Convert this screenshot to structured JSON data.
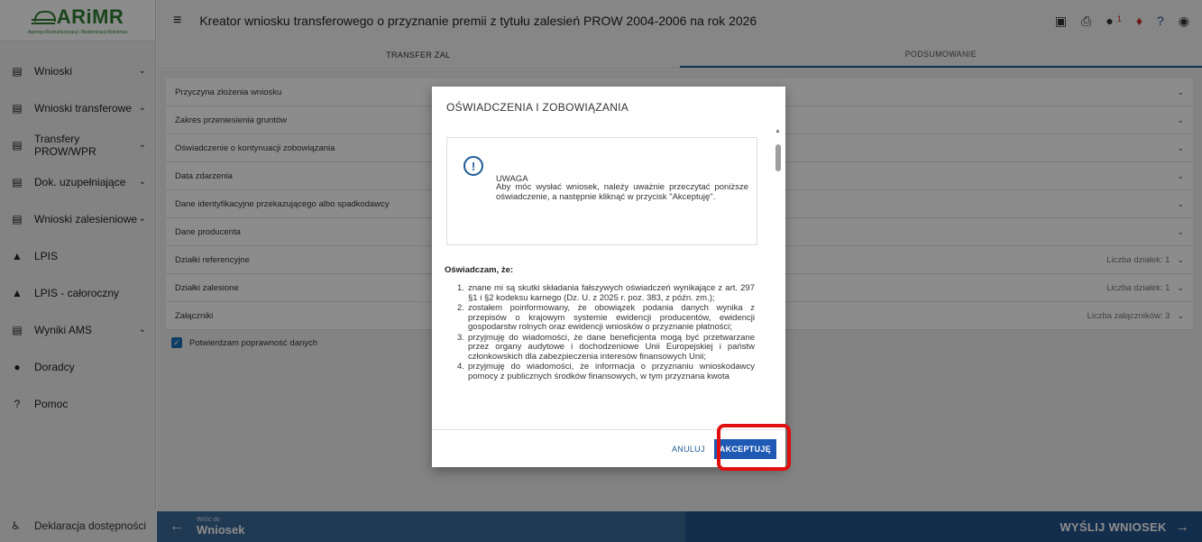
{
  "logo": {
    "brand": "ARiMR",
    "subtitle": "Agencja Restrukturyzacji i Modernizacji Rolnictwa"
  },
  "sidebar": {
    "items": [
      {
        "label": "Wnioski",
        "icon": "clipboard-icon",
        "chevron": "⌄"
      },
      {
        "label": "Wnioski transferowe",
        "icon": "clipboard-icon",
        "chevron": "⌄"
      },
      {
        "label": "Transfery PROW/WPR",
        "icon": "clipboard-icon",
        "chevron": "⌄"
      },
      {
        "label": "Dok. uzupełniające",
        "icon": "clipboard-icon",
        "chevron": "⌄"
      },
      {
        "label": "Wnioski zalesieniowe",
        "icon": "clipboard-icon",
        "chevron": "⌄"
      },
      {
        "label": "LPIS",
        "icon": "terrain-icon",
        "chevron": ""
      },
      {
        "label": "LPIS - całoroczny",
        "icon": "terrain-icon",
        "chevron": ""
      },
      {
        "label": "Wyniki AMS",
        "icon": "clipboard-icon",
        "chevron": "⌄"
      },
      {
        "label": "Doradcy",
        "icon": "person-icon",
        "chevron": ""
      },
      {
        "label": "Pomoc",
        "icon": "help-icon",
        "chevron": ""
      }
    ],
    "footer": "Deklaracja dostępności"
  },
  "topbar": {
    "title": "Kreator wniosku transferowego o przyznanie premii z tytułu zalesień PROW 2004-2006 na rok 2026",
    "notification_count": "1"
  },
  "tabs": [
    {
      "label": "TRANSFER ZAL"
    },
    {
      "label": "PODSUMOWANIE"
    }
  ],
  "panels": [
    {
      "label": "Przyczyna złożenia wniosku",
      "info": ""
    },
    {
      "label": "Zakres przeniesienia gruntów",
      "info": ""
    },
    {
      "label": "Oświadczenie o kontynuacji zobowiązania",
      "info": ""
    },
    {
      "label": "Data zdarzenia",
      "info": ""
    },
    {
      "label": "Dane identyfikacyjne przekazującego albo spadkodawcy",
      "info": ""
    },
    {
      "label": "Dane producenta",
      "info": ""
    },
    {
      "label": "Działki referencyjne",
      "info": "Liczba działek: 1"
    },
    {
      "label": "Działki zalesione",
      "info": "Liczba działek: 1"
    },
    {
      "label": "Załączniki",
      "info": "Liczba załączników: 3"
    }
  ],
  "confirm": {
    "label": "Potwierdzam poprawność danych",
    "checked": true
  },
  "bottombar": {
    "back_small": "Wróć do",
    "back_big": "Wniosek",
    "submit": "WYŚLIJ WNIOSEK"
  },
  "modal": {
    "title": "OŚWIADCZENIA I ZOBOWIĄZANIA",
    "warning_head": "UWAGA",
    "warning_text": "Aby móc wysłać wniosek, należy uważnie przeczytać poniższe oświadczenie, a następnie kliknąć w przycisk \"Akceptuję\".",
    "declaration_head": "Oświadczam, że:",
    "declarations": [
      {
        "num": "1.",
        "text": "znane mi są skutki składania fałszywych oświadczeń wynikające z art. 297 §1 i §2 kodeksu karnego (Dz. U. z 2025 r. poz. 383, z późn. zm.);"
      },
      {
        "num": "2.",
        "text": "zostałem poinformowany, że obowiązek podania danych wynika z przepisów o krajowym systemie ewidencji producentów, ewidencji gospodarstw rolnych oraz ewidencji wniosków o przyznanie płatności;"
      },
      {
        "num": "3.",
        "text": "przyjmuję do wiadomości, że dane beneficjenta mogą być przetwarzane przez organy audytowe i dochodzeniowe Unii Europejskiej i państw członkowskich dla zabezpieczenia interesów finansowych Unii;"
      },
      {
        "num": "4.",
        "text": "przyjmuję do wiadomości, że informacja o przyznaniu wnioskodawcy pomocy z publicznych środków finansowych, w tym przyznana kwota"
      }
    ],
    "cancel_label": "ANULUJ",
    "accept_label": "AKCEPTUJĘ"
  }
}
